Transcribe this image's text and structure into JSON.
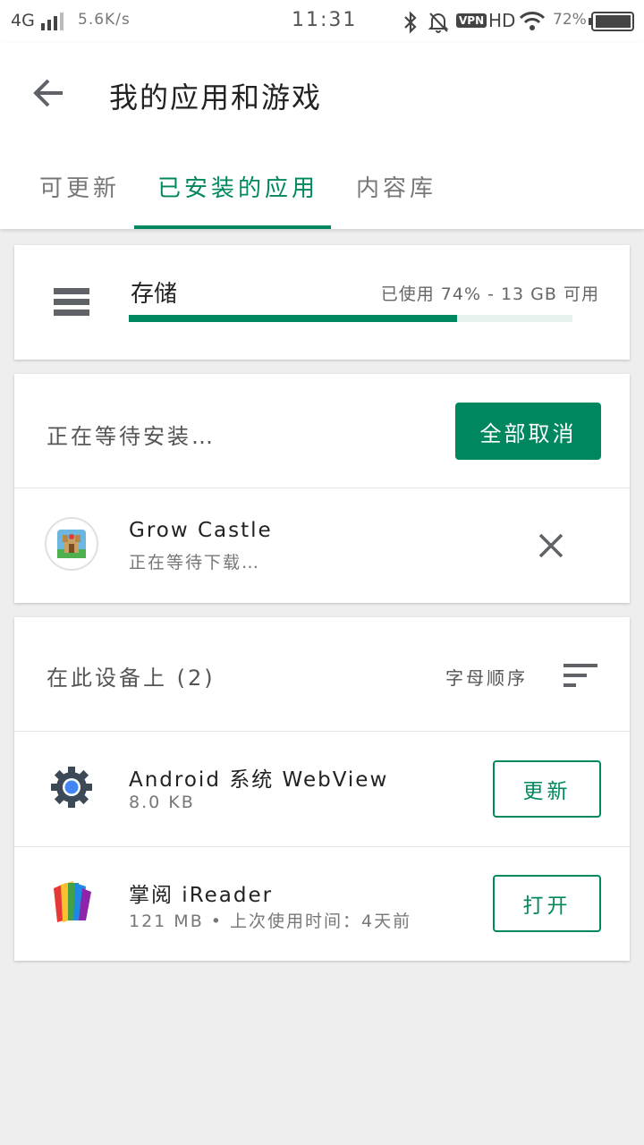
{
  "status_bar": {
    "network": "4G",
    "speed": "5.6K/s",
    "time": "11:31",
    "vpn": "VPN",
    "hd": "HD",
    "battery": "72%"
  },
  "header": {
    "title": "我的应用和游戏",
    "tabs": [
      {
        "label": "可更新",
        "active": false
      },
      {
        "label": "已安装的应用",
        "active": true
      },
      {
        "label": "内容库",
        "active": false
      }
    ]
  },
  "storage": {
    "label": "存储",
    "usage_text": "已使用 74% - 13 GB 可用",
    "used_fraction": 0.74
  },
  "pending": {
    "label": "正在等待安装…",
    "cancel_all_label": "全部取消",
    "items": [
      {
        "name": "Grow Castle",
        "status": "正在等待下载…",
        "icon": "grow-castle-app-icon"
      }
    ]
  },
  "on_device": {
    "label": "在此设备上 (2)",
    "sort_label": "字母顺序",
    "apps": [
      {
        "name": "Android 系统 WebView",
        "detail": "8.0 KB",
        "action": "更新",
        "icon": "android-webview-gear-icon"
      },
      {
        "name": "掌阅 iReader",
        "detail": "121 MB • 上次使用时间：4天前",
        "action": "打开",
        "icon": "ireader-book-icon"
      }
    ]
  },
  "colors": {
    "accent": "#01875f",
    "background": "#eeeeee",
    "card": "#ffffff"
  }
}
